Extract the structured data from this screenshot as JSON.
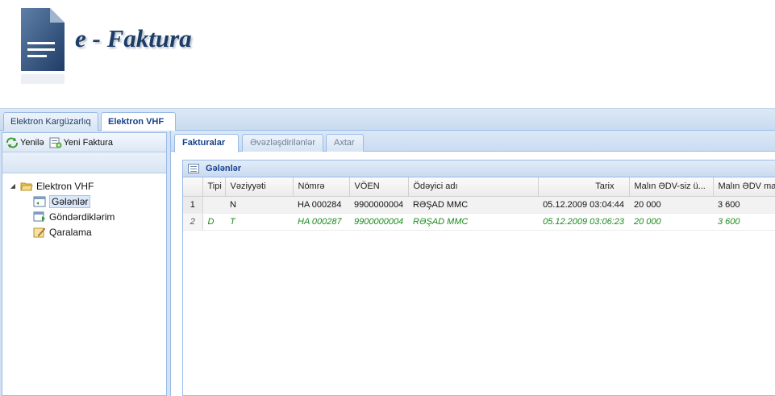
{
  "app": {
    "title": "e - Faktura"
  },
  "main_tabs": [
    {
      "label": "Elektron Kargüzarlıq",
      "active": false
    },
    {
      "label": "Elektron VHF",
      "active": true
    }
  ],
  "toolbar": {
    "refresh_label": "Yenilə",
    "new_invoice_label": "Yeni Faktura"
  },
  "tree": {
    "root": "Elektron VHF",
    "children": [
      {
        "label": "Gələnlər",
        "icon": "inbox-icon",
        "selected": true
      },
      {
        "label": "Göndərdiklərim",
        "icon": "outbox-icon",
        "selected": false
      },
      {
        "label": "Qaralama",
        "icon": "draft-icon",
        "selected": false
      }
    ]
  },
  "sub_tabs": [
    {
      "label": "Fakturalar",
      "active": true
    },
    {
      "label": "Əvəzləşdirilənlər",
      "active": false
    },
    {
      "label": "Axtar",
      "active": false
    }
  ],
  "grid": {
    "title": "Gələnlər",
    "columns": [
      "",
      "Tipi",
      "Vəziyyəti",
      "Nömrə",
      "VÖEN",
      "Ödəyici adı",
      "Tarix",
      "Malın ƏDV-siz ü...",
      "Malın ƏDV ma"
    ],
    "rows": [
      {
        "num": "1",
        "tipi": "",
        "veziyyeti": "N",
        "nomre": "HA 000284",
        "voen": "9900000004",
        "odeyici": "RƏŞAD MMC",
        "tarix": "05.12.2009 03:04:44",
        "edvsiz": "20 000",
        "edv": "3 600"
      },
      {
        "num": "2",
        "tipi": "D",
        "veziyyeti": "T",
        "nomre": "HA 000287",
        "voen": "9900000004",
        "odeyici": "RƏŞAD MMC",
        "tarix": "05.12.2009 03:06:23",
        "edvsiz": "20 000",
        "edv": "3 600"
      }
    ]
  },
  "colors": {
    "accent": "#15428b",
    "row_highlight": "#1b8a1b",
    "tab_border": "#99bbe8"
  }
}
